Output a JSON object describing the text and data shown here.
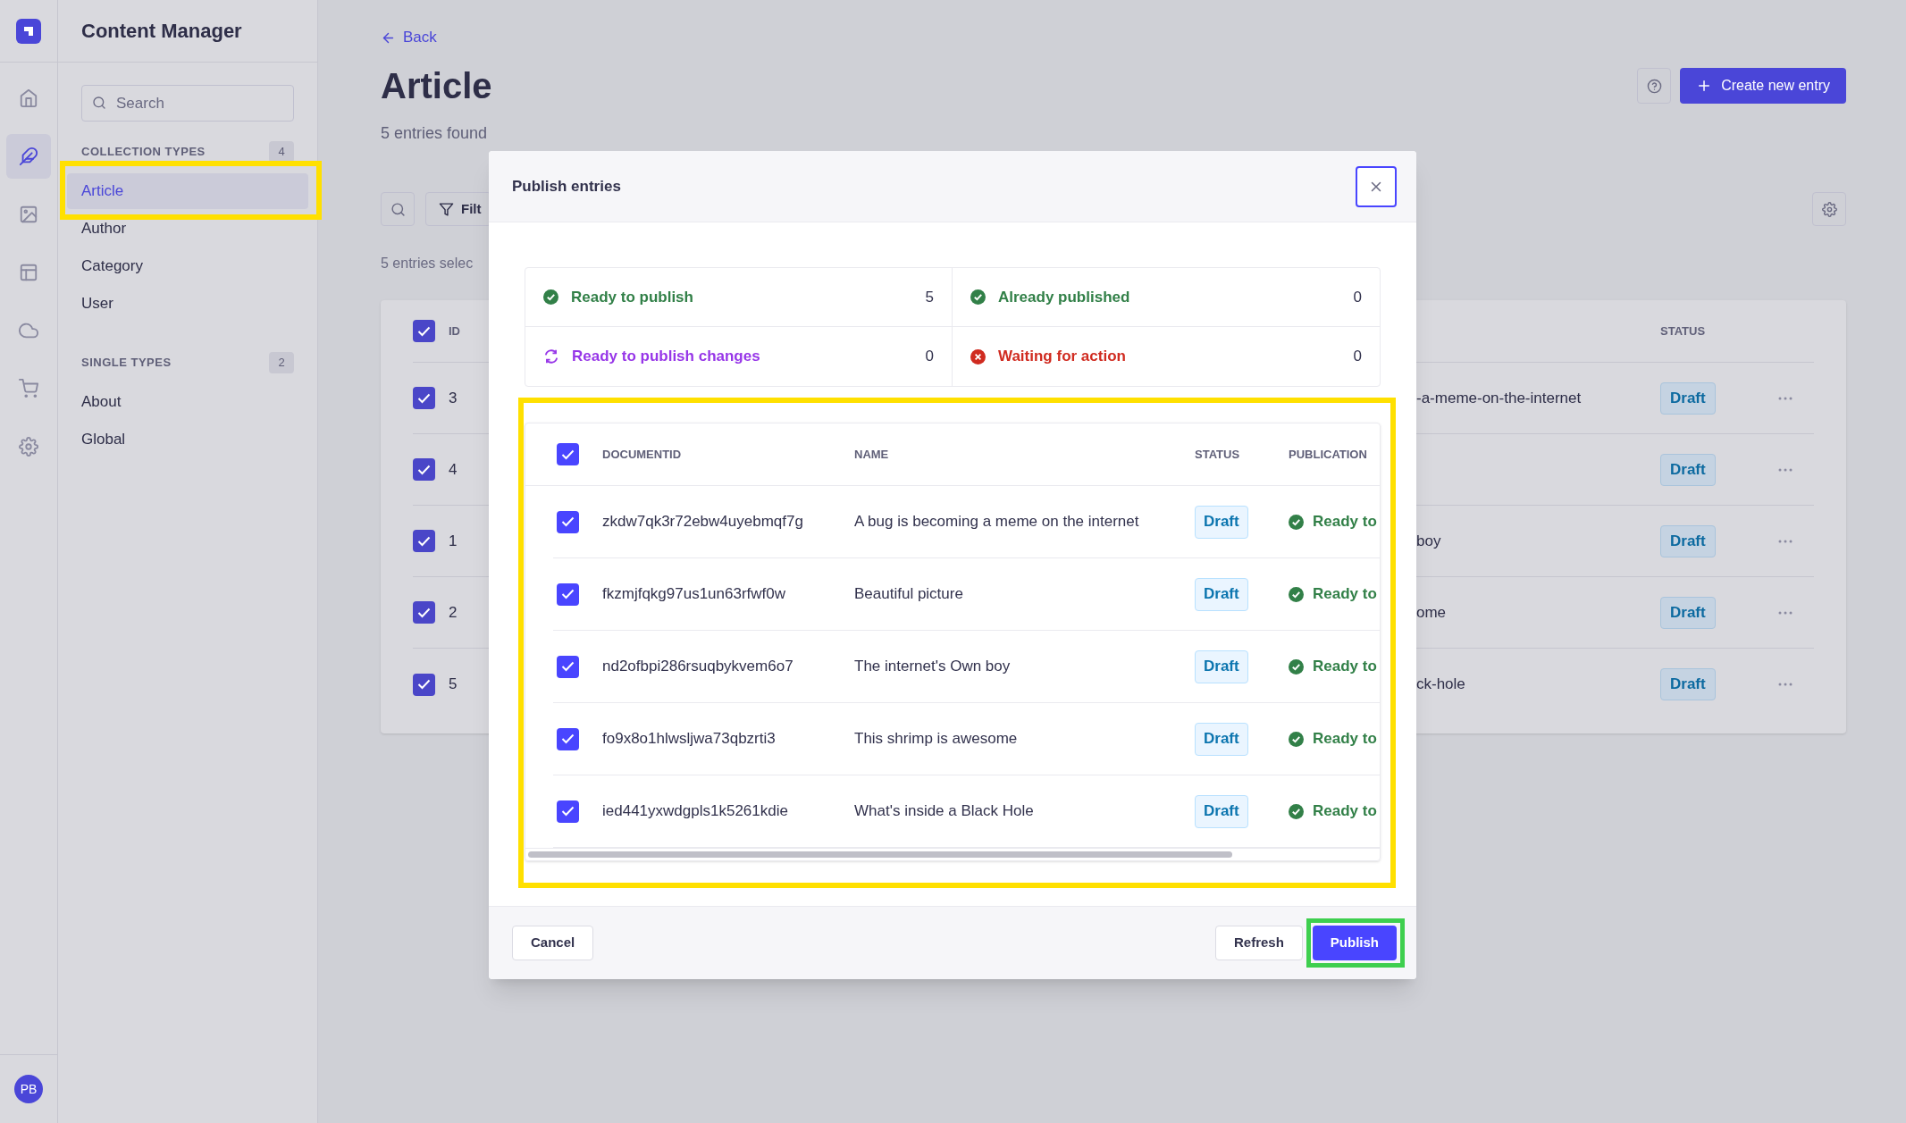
{
  "nav_rail": {
    "items": [
      {
        "selected": false
      },
      {
        "selected": true
      },
      {
        "selected": false
      },
      {
        "selected": false
      },
      {
        "selected": false
      },
      {
        "selected": false
      },
      {
        "selected": false
      }
    ],
    "avatar": "PB"
  },
  "sidebar": {
    "title": "Content Manager",
    "search": {
      "placeholder": "Search"
    },
    "sections": [
      {
        "heading": "COLLECTION TYPES",
        "count": "4",
        "items": [
          {
            "label": "Article",
            "selected": true
          },
          {
            "label": "Author",
            "selected": false
          },
          {
            "label": "Category",
            "selected": false
          },
          {
            "label": "User",
            "selected": false
          }
        ]
      },
      {
        "heading": "SINGLE TYPES",
        "count": "2",
        "items": [
          {
            "label": "About",
            "selected": false
          },
          {
            "label": "Global",
            "selected": false
          }
        ]
      }
    ]
  },
  "page": {
    "back": "Back",
    "title": "Article",
    "subtitle": "5 entries found",
    "create_button": "Create new entry",
    "filter_button": "Filt",
    "selection_note": "5 entries selec",
    "table": {
      "header_checked": true,
      "columns": [
        "ID",
        "STATUS"
      ],
      "rows": [
        {
          "checked": true,
          "id": "3",
          "slug": "-a-meme-on-the-internet",
          "status": "Draft"
        },
        {
          "checked": true,
          "id": "4",
          "status": "Draft"
        },
        {
          "checked": true,
          "id": "1",
          "slug": "boy",
          "status": "Draft"
        },
        {
          "checked": true,
          "id": "2",
          "slug": "ome",
          "status": "Draft"
        },
        {
          "checked": true,
          "id": "5",
          "slug": "ck-hole",
          "status": "Draft"
        }
      ]
    }
  },
  "modal": {
    "title": "Publish entries",
    "stats": [
      {
        "kind": "ready",
        "label": "Ready to publish",
        "count": "5"
      },
      {
        "kind": "ready",
        "label": "Already published",
        "count": "0"
      },
      {
        "kind": "changes",
        "label": "Ready to publish changes",
        "count": "0"
      },
      {
        "kind": "error",
        "label": "Waiting for action",
        "count": "0"
      }
    ],
    "table": {
      "header_checked": true,
      "columns": [
        "DOCUMENTID",
        "NAME",
        "STATUS",
        "PUBLICATION"
      ],
      "rows": [
        {
          "checked": true,
          "document_id": "zkdw7qk3r72ebw4uyebmqf7g",
          "name": "A bug is becoming a meme on the internet",
          "status": "Draft",
          "publication": "Ready to",
          "kind": "ready"
        },
        {
          "checked": true,
          "document_id": "fkzmjfqkg97us1un63rfwf0w",
          "name": "Beautiful picture",
          "status": "Draft",
          "publication": "Ready to",
          "kind": "ready"
        },
        {
          "checked": true,
          "document_id": "nd2ofbpi286rsuqbykvem6o7",
          "name": "The internet's Own boy",
          "status": "Draft",
          "publication": "Ready to",
          "kind": "ready"
        },
        {
          "checked": true,
          "document_id": "fo9x8o1hlwsljwa73qbzrti3",
          "name": "This shrimp is awesome",
          "status": "Draft",
          "publication": "Ready to",
          "kind": "ready"
        },
        {
          "checked": true,
          "document_id": "ied441yxwdgpls1k5261kdie",
          "name": "What's inside a Black Hole",
          "status": "Draft",
          "publication": "Ready to",
          "kind": "ready"
        }
      ]
    },
    "buttons": {
      "cancel": "Cancel",
      "refresh": "Refresh",
      "publish": "Publish"
    }
  },
  "highlights": [
    {
      "color": "#ffe000"
    },
    {
      "color": "#ffe000"
    },
    {
      "color": "#3ecf4f"
    }
  ]
}
